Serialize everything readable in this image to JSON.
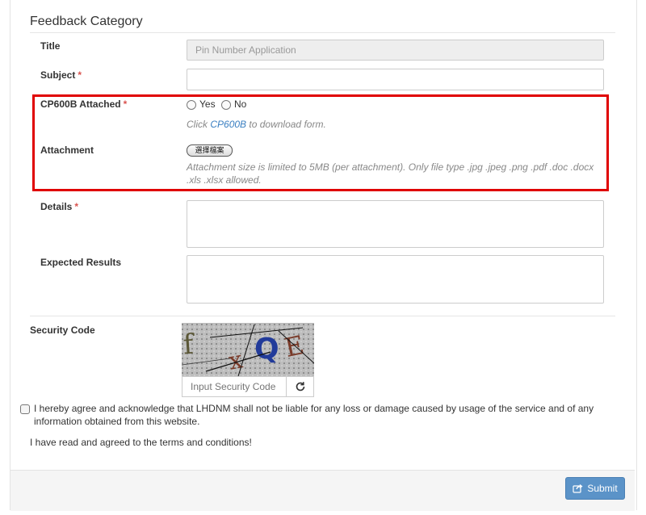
{
  "form": {
    "legend": "Feedback Category",
    "title": {
      "label": "Title",
      "value": "Pin Number Application"
    },
    "subject": {
      "label": "Subject",
      "required_mark": "*",
      "value": ""
    },
    "cp600b": {
      "label": "CP600B Attached",
      "required_mark": "*",
      "options": [
        "Yes",
        "No"
      ],
      "hint_prefix": "Click",
      "hint_link": "CP600B",
      "hint_suffix": "to download form."
    },
    "attachment": {
      "label": "Attachment",
      "button_label": "選擇檔案",
      "hint_line1": "Attachment size is limited to 5MB (per attachment). Only file type .jpg .jpeg .png .pdf .doc .docx",
      "hint_line2": ".xls .xlsx allowed."
    },
    "details": {
      "label": "Details",
      "required_mark": "*"
    },
    "expected": {
      "label": "Expected Results"
    },
    "security": {
      "label": "Security Code",
      "captcha_text": "f x Q E",
      "input_placeholder": "Input Security Code",
      "refresh_icon": "refresh-icon"
    },
    "agreement": "I hereby agree and acknowledge that LHDNM shall not be liable for any loss or damage caused by usage of the service and of any information obtained from this website.",
    "agreed_text": "I have read and agreed to the terms and conditions!",
    "submit_label": "Submit"
  },
  "colors": {
    "highlight": "#e00000",
    "required": "#d9534f",
    "link": "#3a7fc1",
    "submit": "#5b93c8"
  }
}
